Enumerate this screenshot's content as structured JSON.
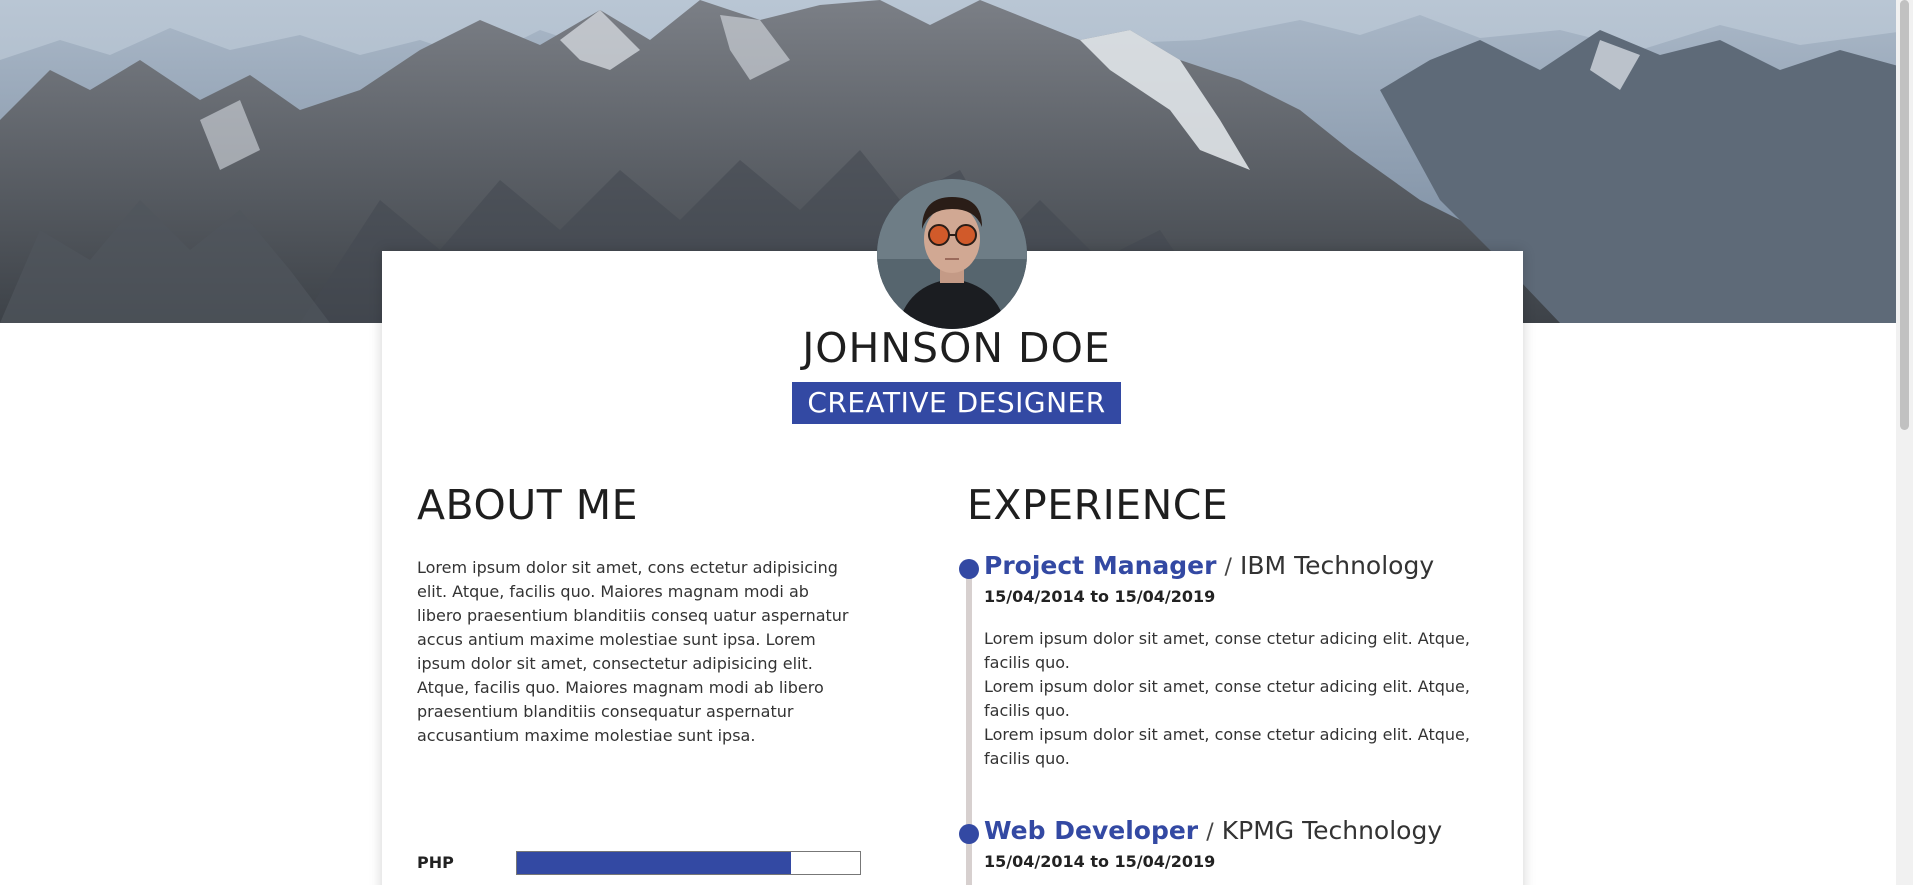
{
  "profile": {
    "name": "JOHNSON DOE",
    "role": "CREATIVE DESIGNER"
  },
  "about": {
    "title": "ABOUT ME",
    "text": "Lorem ipsum dolor sit amet, cons ectetur adipisicing elit. Atque, facilis quo. Maiores magnam modi ab libero praesentium blanditiis conseq uatur aspernatur accus antium maxime molestiae sunt ipsa. Lorem ipsum dolor sit amet, consectetur adipisicing elit. Atque, facilis quo. Maiores magnam modi ab libero praesentium blanditiis consequatur aspernatur accusantium maxime molestiae sunt ipsa."
  },
  "skills": [
    {
      "name": "PHP",
      "level": 0.8
    }
  ],
  "experience": {
    "title": "EXPERIENCE",
    "items": [
      {
        "role": "Project Manager",
        "separator": "/",
        "company": "IBM Technology",
        "dates": "15/04/2014 to 15/04/2019",
        "lines": [
          "Lorem ipsum dolor sit amet, conse ctetur adicing elit. Atque, facilis quo.",
          "Lorem ipsum dolor sit amet, conse ctetur adicing elit. Atque, facilis quo.",
          "Lorem ipsum dolor sit amet, conse ctetur adicing elit. Atque, facilis quo."
        ]
      },
      {
        "role": "Web Developer",
        "separator": "/",
        "company": "KPMG Technology",
        "dates": "15/04/2014 to 15/04/2019"
      }
    ]
  },
  "colors": {
    "accent": "#3349a3",
    "timeline": "#d7d0cf"
  }
}
